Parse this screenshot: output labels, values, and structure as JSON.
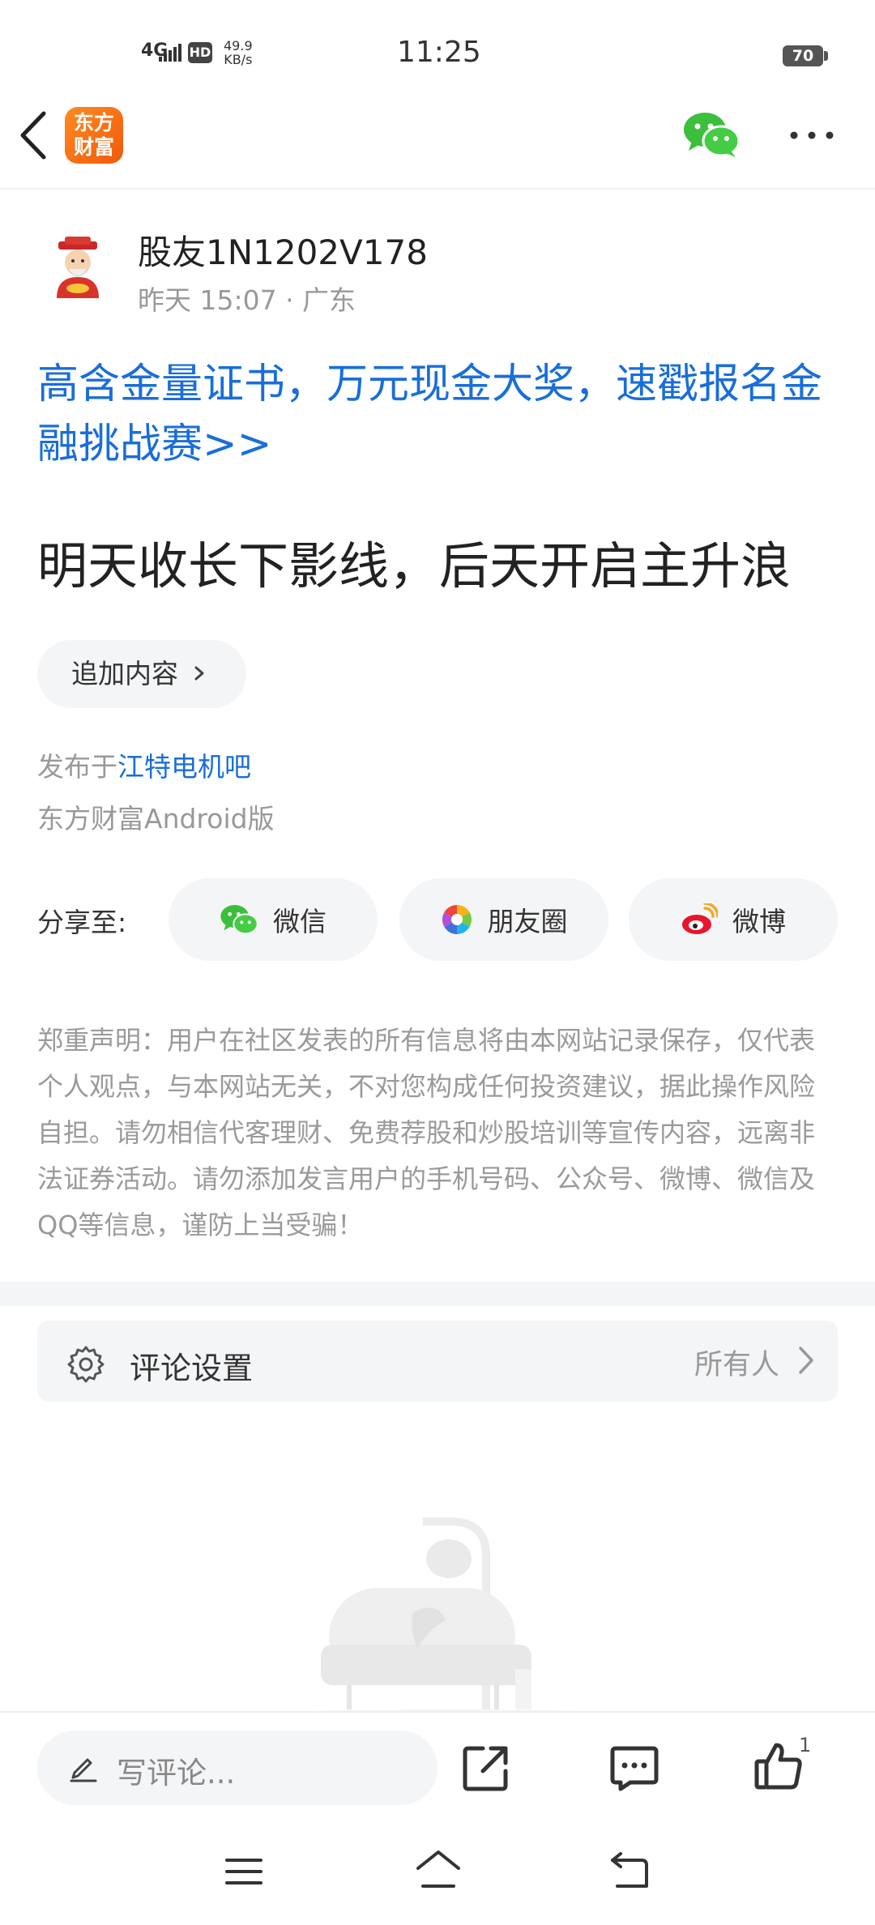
{
  "status_bar": {
    "network": "4G",
    "hd": "HD",
    "speed_value": "49.9",
    "speed_unit": "KB/s",
    "time": "11:25",
    "battery": "70"
  },
  "nav": {
    "app_logo_line1": "东方",
    "app_logo_line2": "财富",
    "icons": [
      "back-icon",
      "wechat-icon",
      "more-icon"
    ]
  },
  "post": {
    "author": "股友1N1202V178",
    "meta": "昨天 15:07 · 广东",
    "promo": "高含金量证书，万元现金大奖，速戳报名金融挑战赛>>",
    "title": "明天收长下影线，后天开启主升浪",
    "append_label": "追加内容",
    "published_prefix": "发布于",
    "published_forum": "江特电机吧",
    "client": "东方财富Android版"
  },
  "share": {
    "label": "分享至:",
    "wechat": "微信",
    "moments": "朋友圈",
    "weibo": "微博"
  },
  "disclaimer": "郑重声明：用户在社区发表的所有信息将由本网站记录保存，仅代表个人观点，与本网站无关，不对您构成任何投资建议，据此操作风险自担。请勿相信代客理财、免费荐股和炒股培训等宣传内容，远离非法证券活动。请勿添加发言用户的手机号码、公众号、微博、微信及QQ等信息，谨防上当受骗！",
  "comment_settings": {
    "label": "评论设置",
    "value": "所有人"
  },
  "bottom_bar": {
    "comment_placeholder": "写评论...",
    "like_count": "1"
  },
  "colors": {
    "link_blue": "#1a6ed8",
    "brand_orange": "#f5701a",
    "wechat_green": "#2dc100",
    "weibo_red": "#e6162d"
  }
}
